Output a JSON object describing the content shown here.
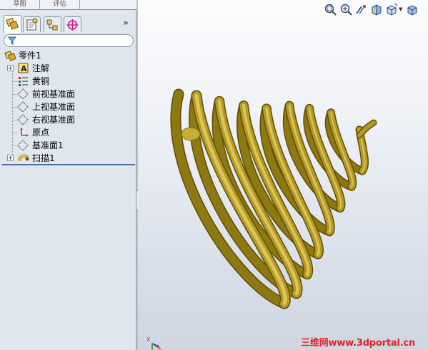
{
  "command_manager": {
    "tabs": [
      {
        "label": "草图"
      },
      {
        "label": "评估"
      }
    ]
  },
  "manager_tabs": [
    {
      "icon": "feature-manager-icon"
    },
    {
      "icon": "property-manager-icon"
    },
    {
      "icon": "configuration-manager-icon"
    },
    {
      "icon": "display-manager-icon"
    }
  ],
  "collapse_chevron": "»",
  "filter": {
    "icon": "filter-funnel-icon",
    "placeholder": ""
  },
  "tree": {
    "items": [
      {
        "label": "零件1",
        "icon": "part-icon",
        "expandable": false
      },
      {
        "label": "注解",
        "icon": "annotations-icon",
        "expandable": true
      },
      {
        "label": "黄铜",
        "icon": "material-icon",
        "expandable": false
      },
      {
        "label": "前视基准面",
        "icon": "plane-icon",
        "expandable": false
      },
      {
        "label": "上视基准面",
        "icon": "plane-icon",
        "expandable": false
      },
      {
        "label": "右视基准面",
        "icon": "plane-icon",
        "expandable": false
      },
      {
        "label": "原点",
        "icon": "origin-icon",
        "expandable": false
      },
      {
        "label": "基准面1",
        "icon": "plane-icon",
        "expandable": false
      },
      {
        "label": "扫描1",
        "icon": "sweep-feature-icon",
        "expandable": true
      }
    ]
  },
  "view_toolbar": {
    "buttons": [
      {
        "icon": "zoom-to-fit-icon"
      },
      {
        "icon": "zoom-to-area-icon"
      },
      {
        "icon": "previous-view-icon"
      },
      {
        "icon": "section-view-icon"
      },
      {
        "icon": "view-orientation-icon"
      },
      {
        "icon": "display-style-icon"
      }
    ]
  },
  "triad": {
    "axis_label": "X"
  },
  "colors": {
    "model_gold": "#b59a1f",
    "viewport_top": "#fbfcfd",
    "viewport_bottom": "#cfd6e2",
    "watermark": "#e8202a"
  },
  "watermark": "三维网www.3dportal.cn"
}
